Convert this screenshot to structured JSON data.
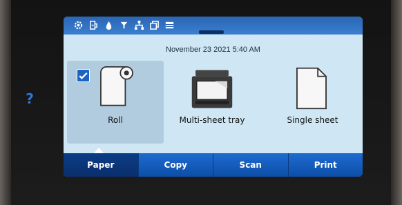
{
  "help": {
    "label": "?"
  },
  "status_icons": [
    "settings-icon",
    "network-icon",
    "ink-icon",
    "printhead-icon",
    "connectivity-icon",
    "copy-status-icon",
    "storage-icon"
  ],
  "datetime": "November 23 2021 5:40 AM",
  "tiles": [
    {
      "label": "Roll",
      "selected": true
    },
    {
      "label": "Multi-sheet tray",
      "selected": false
    },
    {
      "label": "Single sheet",
      "selected": false
    }
  ],
  "tabs": [
    {
      "label": "Paper",
      "active": true
    },
    {
      "label": "Copy",
      "active": false
    },
    {
      "label": "Scan",
      "active": false
    },
    {
      "label": "Print",
      "active": false
    }
  ],
  "colors": {
    "accent": "#1e6bd0",
    "screen_bg": "#cfe7f4",
    "selected_tile": "#b1ccdf",
    "active_tab": "#0c3c86"
  }
}
